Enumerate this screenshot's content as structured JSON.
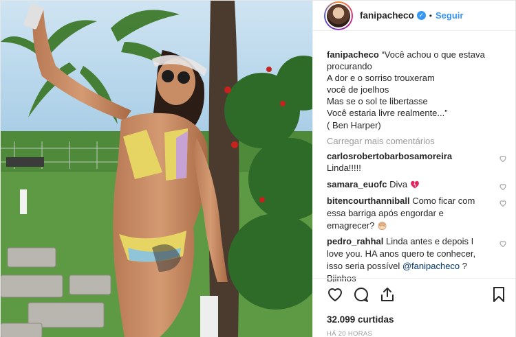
{
  "post": {
    "username": "fanipacheco",
    "verified_mark": "✓",
    "separator": "•",
    "follow_label": "Seguir",
    "caption_user": "fanipacheco",
    "caption_text": " “Você achou o que estava procurando\nA dor e o sorriso trouxeram\nvocê de joelhos\nMas se o sol te libertasse\nVocê estaria livre realmente...”\n( Ben Harper)",
    "load_more": "Carregar mais comentários",
    "likes": "32.099 curtidas",
    "timestamp": "HÁ 20 HORAS"
  },
  "comments": [
    {
      "user": "carlosrobertobarbosamoreira",
      "text": "Linda!!!!!",
      "newline": true
    },
    {
      "user": "samara_euofc",
      "text": "Diva",
      "emoji": "heart-emoji"
    },
    {
      "user": "bitencourthanniball",
      "text": "Como ficar com essa barriga após engordar e emagrecer?",
      "emoji": "facepalm-emoji"
    },
    {
      "user": "pedro_rahhal",
      "text": "Linda antes e depois I love you. HA anos quero te conhecer, isso seria possível",
      "mention": "@fanipacheco",
      "tail": "? Bjinhos"
    }
  ],
  "icons": {
    "like": "heart-outline-icon",
    "comment": "speech-bubble-icon",
    "share": "share-upload-icon",
    "save": "bookmark-icon",
    "comment_like": "small-heart-icon"
  },
  "colors": {
    "link": "#3897f0",
    "muted": "#999999",
    "text": "#262626"
  }
}
